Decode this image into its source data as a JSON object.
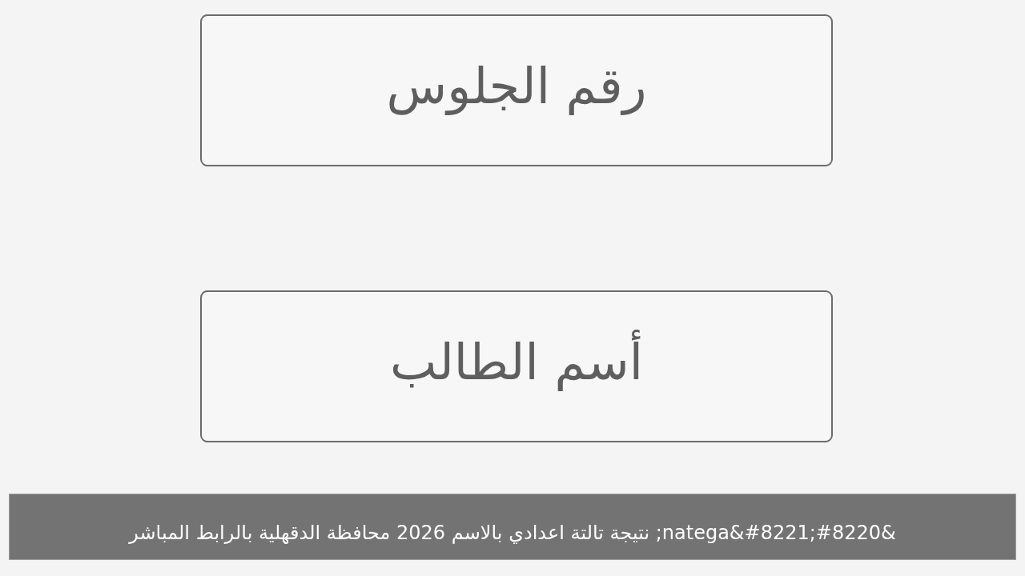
{
  "form_image": {
    "fields": [
      {
        "label": "رقم الجلوس"
      },
      {
        "label": "أسم الطالب"
      }
    ]
  },
  "caption": {
    "text": "&#8220;natega&#8221; نتيجة تالتة اعدادي بالاسم 2026 محافظة الدقهلية بالرابط المباشر"
  }
}
